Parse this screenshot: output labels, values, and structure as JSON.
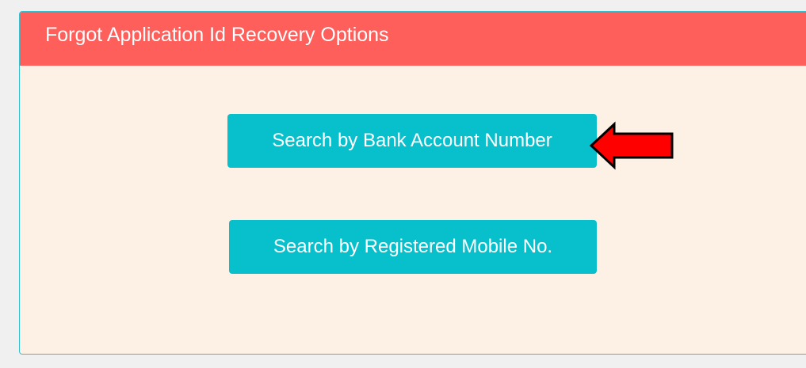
{
  "panel": {
    "title": "Forgot Application Id Recovery Options"
  },
  "options": {
    "bank_account_label": "Search by Bank Account Number",
    "mobile_label": "Search by Registered Mobile No."
  },
  "annotation": {
    "arrow_icon": "red-left-arrow-icon"
  },
  "colors": {
    "header_bg": "#ff5f5b",
    "panel_bg": "#fdf1e6",
    "panel_border": "#32c2cf",
    "button_bg": "#07c0cc",
    "arrow_fill": "#ff0000"
  }
}
